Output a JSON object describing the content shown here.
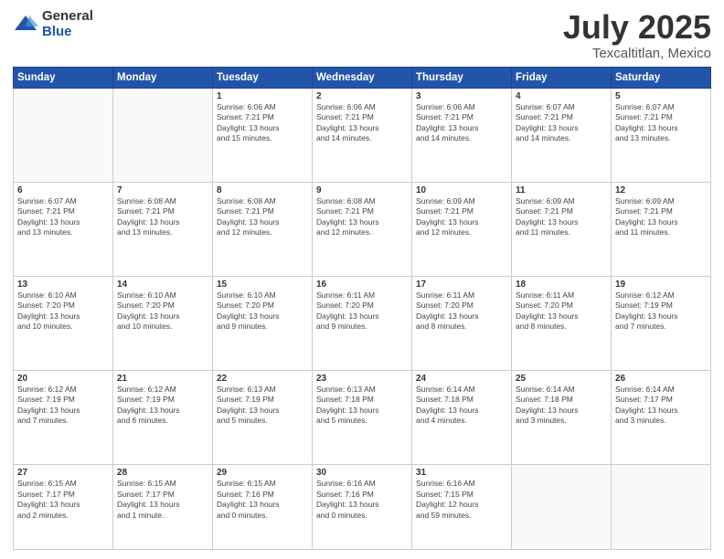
{
  "logo": {
    "general": "General",
    "blue": "Blue"
  },
  "title": "July 2025",
  "subtitle": "Texcaltitlan, Mexico",
  "days_of_week": [
    "Sunday",
    "Monday",
    "Tuesday",
    "Wednesday",
    "Thursday",
    "Friday",
    "Saturday"
  ],
  "weeks": [
    [
      {
        "day": "",
        "info": ""
      },
      {
        "day": "",
        "info": ""
      },
      {
        "day": "1",
        "info": "Sunrise: 6:06 AM\nSunset: 7:21 PM\nDaylight: 13 hours\nand 15 minutes."
      },
      {
        "day": "2",
        "info": "Sunrise: 6:06 AM\nSunset: 7:21 PM\nDaylight: 13 hours\nand 14 minutes."
      },
      {
        "day": "3",
        "info": "Sunrise: 6:06 AM\nSunset: 7:21 PM\nDaylight: 13 hours\nand 14 minutes."
      },
      {
        "day": "4",
        "info": "Sunrise: 6:07 AM\nSunset: 7:21 PM\nDaylight: 13 hours\nand 14 minutes."
      },
      {
        "day": "5",
        "info": "Sunrise: 6:07 AM\nSunset: 7:21 PM\nDaylight: 13 hours\nand 13 minutes."
      }
    ],
    [
      {
        "day": "6",
        "info": "Sunrise: 6:07 AM\nSunset: 7:21 PM\nDaylight: 13 hours\nand 13 minutes."
      },
      {
        "day": "7",
        "info": "Sunrise: 6:08 AM\nSunset: 7:21 PM\nDaylight: 13 hours\nand 13 minutes."
      },
      {
        "day": "8",
        "info": "Sunrise: 6:08 AM\nSunset: 7:21 PM\nDaylight: 13 hours\nand 12 minutes."
      },
      {
        "day": "9",
        "info": "Sunrise: 6:08 AM\nSunset: 7:21 PM\nDaylight: 13 hours\nand 12 minutes."
      },
      {
        "day": "10",
        "info": "Sunrise: 6:09 AM\nSunset: 7:21 PM\nDaylight: 13 hours\nand 12 minutes."
      },
      {
        "day": "11",
        "info": "Sunrise: 6:09 AM\nSunset: 7:21 PM\nDaylight: 13 hours\nand 11 minutes."
      },
      {
        "day": "12",
        "info": "Sunrise: 6:09 AM\nSunset: 7:21 PM\nDaylight: 13 hours\nand 11 minutes."
      }
    ],
    [
      {
        "day": "13",
        "info": "Sunrise: 6:10 AM\nSunset: 7:20 PM\nDaylight: 13 hours\nand 10 minutes."
      },
      {
        "day": "14",
        "info": "Sunrise: 6:10 AM\nSunset: 7:20 PM\nDaylight: 13 hours\nand 10 minutes."
      },
      {
        "day": "15",
        "info": "Sunrise: 6:10 AM\nSunset: 7:20 PM\nDaylight: 13 hours\nand 9 minutes."
      },
      {
        "day": "16",
        "info": "Sunrise: 6:11 AM\nSunset: 7:20 PM\nDaylight: 13 hours\nand 9 minutes."
      },
      {
        "day": "17",
        "info": "Sunrise: 6:11 AM\nSunset: 7:20 PM\nDaylight: 13 hours\nand 8 minutes."
      },
      {
        "day": "18",
        "info": "Sunrise: 6:11 AM\nSunset: 7:20 PM\nDaylight: 13 hours\nand 8 minutes."
      },
      {
        "day": "19",
        "info": "Sunrise: 6:12 AM\nSunset: 7:19 PM\nDaylight: 13 hours\nand 7 minutes."
      }
    ],
    [
      {
        "day": "20",
        "info": "Sunrise: 6:12 AM\nSunset: 7:19 PM\nDaylight: 13 hours\nand 7 minutes."
      },
      {
        "day": "21",
        "info": "Sunrise: 6:12 AM\nSunset: 7:19 PM\nDaylight: 13 hours\nand 6 minutes."
      },
      {
        "day": "22",
        "info": "Sunrise: 6:13 AM\nSunset: 7:19 PM\nDaylight: 13 hours\nand 5 minutes."
      },
      {
        "day": "23",
        "info": "Sunrise: 6:13 AM\nSunset: 7:18 PM\nDaylight: 13 hours\nand 5 minutes."
      },
      {
        "day": "24",
        "info": "Sunrise: 6:14 AM\nSunset: 7:18 PM\nDaylight: 13 hours\nand 4 minutes."
      },
      {
        "day": "25",
        "info": "Sunrise: 6:14 AM\nSunset: 7:18 PM\nDaylight: 13 hours\nand 3 minutes."
      },
      {
        "day": "26",
        "info": "Sunrise: 6:14 AM\nSunset: 7:17 PM\nDaylight: 13 hours\nand 3 minutes."
      }
    ],
    [
      {
        "day": "27",
        "info": "Sunrise: 6:15 AM\nSunset: 7:17 PM\nDaylight: 13 hours\nand 2 minutes."
      },
      {
        "day": "28",
        "info": "Sunrise: 6:15 AM\nSunset: 7:17 PM\nDaylight: 13 hours\nand 1 minute."
      },
      {
        "day": "29",
        "info": "Sunrise: 6:15 AM\nSunset: 7:16 PM\nDaylight: 13 hours\nand 0 minutes."
      },
      {
        "day": "30",
        "info": "Sunrise: 6:16 AM\nSunset: 7:16 PM\nDaylight: 13 hours\nand 0 minutes."
      },
      {
        "day": "31",
        "info": "Sunrise: 6:16 AM\nSunset: 7:15 PM\nDaylight: 12 hours\nand 59 minutes."
      },
      {
        "day": "",
        "info": ""
      },
      {
        "day": "",
        "info": ""
      }
    ]
  ]
}
